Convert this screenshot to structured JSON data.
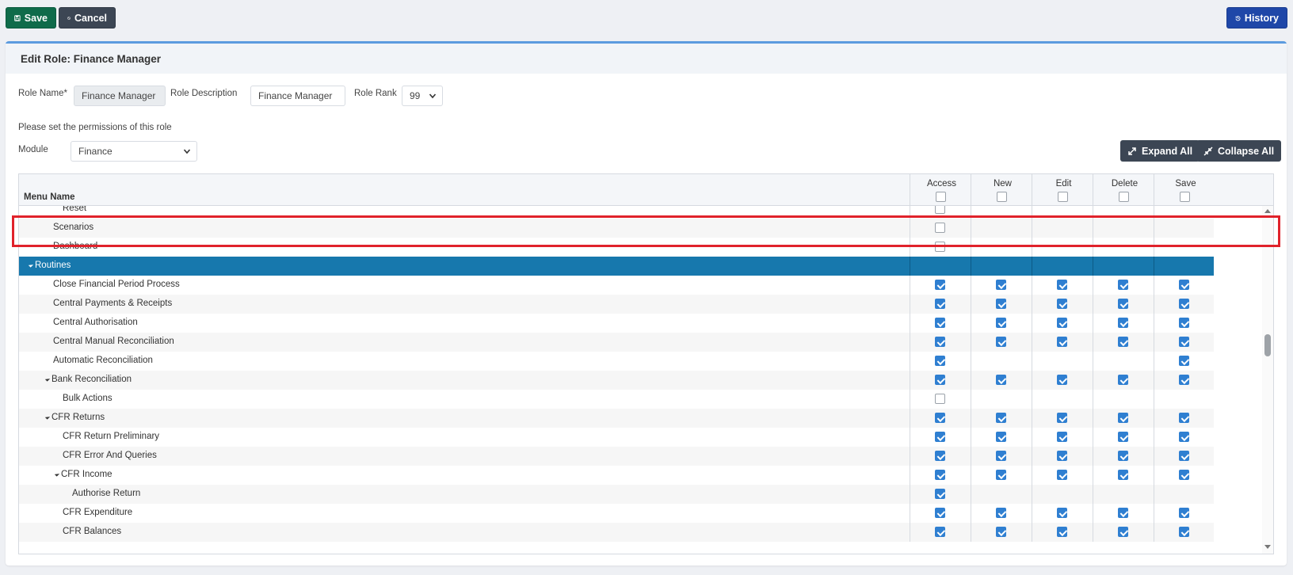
{
  "toolbar": {
    "save_label": "Save",
    "cancel_label": "Cancel",
    "history_label": "History"
  },
  "card": {
    "title": "Edit Role: Finance Manager"
  },
  "form": {
    "role_name_label": "Role Name*",
    "role_name_value": "Finance Manager",
    "role_description_label": "Role Description",
    "role_description_value": "Finance Manager",
    "role_rank_label": "Role Rank",
    "role_rank_value": "99",
    "permissions_note": "Please set the permissions of this role",
    "module_label": "Module",
    "module_value": "Finance"
  },
  "actions": {
    "expand_all": "Expand All",
    "collapse_all": "Collapse All"
  },
  "grid": {
    "menu_name_header": "Menu Name",
    "columns": [
      "Access",
      "New",
      "Edit",
      "Delete",
      "Save"
    ],
    "rows": [
      {
        "name": "Reset",
        "indent": 3,
        "caret": false,
        "group": false,
        "cells": [
          "off",
          null,
          null,
          null,
          null
        ]
      },
      {
        "name": "Scenarios",
        "indent": 2,
        "caret": false,
        "group": false,
        "cells": [
          "off",
          null,
          null,
          null,
          null
        ]
      },
      {
        "name": "Dashboard",
        "indent": 2,
        "caret": false,
        "group": false,
        "cells": [
          "off",
          null,
          null,
          null,
          null
        ]
      },
      {
        "name": "Routines",
        "indent": 1,
        "caret": true,
        "group": true,
        "cells": [
          null,
          null,
          null,
          null,
          null
        ]
      },
      {
        "name": "Close Financial Period Process",
        "indent": 2,
        "caret": false,
        "group": false,
        "cells": [
          "on",
          "on",
          "on",
          "on",
          "on"
        ]
      },
      {
        "name": "Central Payments & Receipts",
        "indent": 2,
        "caret": false,
        "group": false,
        "cells": [
          "on",
          "on",
          "on",
          "on",
          "on"
        ]
      },
      {
        "name": "Central Authorisation",
        "indent": 2,
        "caret": false,
        "group": false,
        "cells": [
          "on",
          "on",
          "on",
          "on",
          "on"
        ]
      },
      {
        "name": "Central Manual Reconciliation",
        "indent": 2,
        "caret": false,
        "group": false,
        "cells": [
          "on",
          "on",
          "on",
          "on",
          "on"
        ]
      },
      {
        "name": "Automatic Reconciliation",
        "indent": 2,
        "caret": false,
        "group": false,
        "cells": [
          "on",
          null,
          null,
          null,
          "on"
        ]
      },
      {
        "name": "Bank Reconciliation",
        "indent": 2,
        "caret": true,
        "group": false,
        "cells": [
          "on",
          "on",
          "on",
          "on",
          "on"
        ]
      },
      {
        "name": "Bulk Actions",
        "indent": 3,
        "caret": false,
        "group": false,
        "cells": [
          "off",
          null,
          null,
          null,
          null
        ]
      },
      {
        "name": "CFR Returns",
        "indent": 2,
        "caret": true,
        "group": false,
        "cells": [
          "on",
          "on",
          "on",
          "on",
          "on"
        ]
      },
      {
        "name": "CFR Return Preliminary",
        "indent": 3,
        "caret": false,
        "group": false,
        "cells": [
          "on",
          "on",
          "on",
          "on",
          "on"
        ]
      },
      {
        "name": "CFR Error And Queries",
        "indent": 3,
        "caret": false,
        "group": false,
        "cells": [
          "on",
          "on",
          "on",
          "on",
          "on"
        ]
      },
      {
        "name": "CFR Income",
        "indent": 3,
        "caret": true,
        "group": false,
        "cells": [
          "on",
          "on",
          "on",
          "on",
          "on"
        ]
      },
      {
        "name": "Authorise Return",
        "indent": 4,
        "caret": false,
        "group": false,
        "cells": [
          "on",
          null,
          null,
          null,
          null
        ]
      },
      {
        "name": "CFR Expenditure",
        "indent": 3,
        "caret": false,
        "group": false,
        "cells": [
          "on",
          "on",
          "on",
          "on",
          "on"
        ]
      },
      {
        "name": "CFR Balances",
        "indent": 3,
        "caret": false,
        "group": false,
        "cells": [
          "on",
          "on",
          "on",
          "on",
          "on"
        ]
      }
    ]
  },
  "colors": {
    "accent": "#2f7fd1",
    "group_row": "#1778ad",
    "highlight": "#e0222b",
    "save": "#0f6b4a",
    "history": "#1f47a8"
  }
}
